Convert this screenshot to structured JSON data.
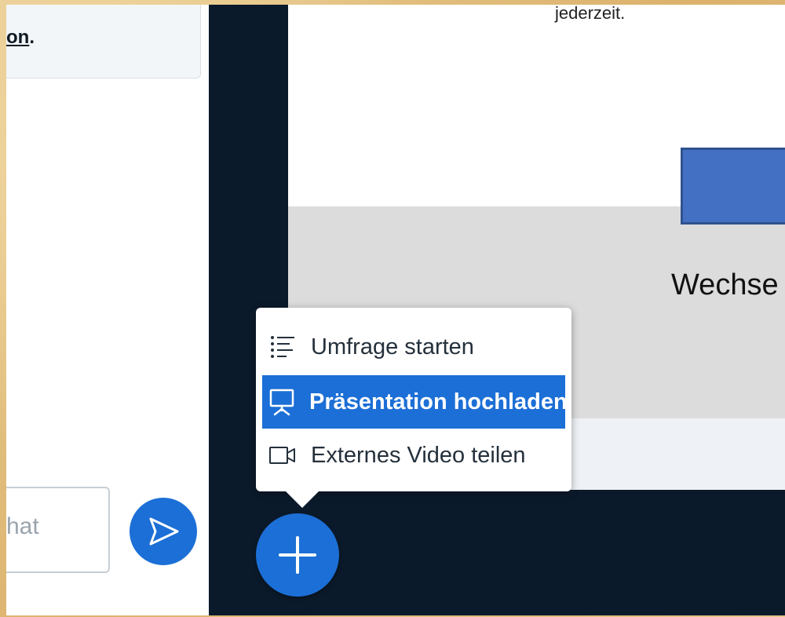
{
  "chat": {
    "message_fragment_link": "on",
    "message_fragment_tail": ".",
    "input_placeholder": "hat"
  },
  "slide": {
    "top_text": "jederzeit.",
    "heading_fragment": "Wechse"
  },
  "actions_menu": {
    "items": [
      {
        "label": "Umfrage starten",
        "icon": "poll-list-icon",
        "selected": false
      },
      {
        "label": "Präsentation hochladen",
        "icon": "presentation-icon",
        "selected": true
      },
      {
        "label": "Externes Video teilen",
        "icon": "video-camera-icon",
        "selected": false
      }
    ]
  },
  "colors": {
    "accent": "#1c6fd6",
    "dark_bg": "#0b1a2b",
    "frame": "#e4c384"
  }
}
